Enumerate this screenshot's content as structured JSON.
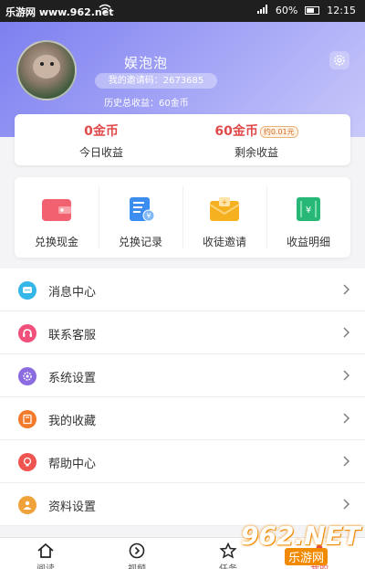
{
  "statusbar": {
    "source": "乐游网 www.962.net",
    "signal": "60%",
    "time": "12:15"
  },
  "profile": {
    "name": "娱泡泡",
    "invite_code": "我的邀请码：2673685",
    "history_earnings": "历史总收益：60金币"
  },
  "earnings": {
    "today_value": "0金币",
    "today_label": "今日收益",
    "remaining_value": "60金币",
    "remaining_badge": "约0.01元",
    "remaining_label": "剩余收益"
  },
  "actions": [
    {
      "label": "兑换现金",
      "icon": "wallet-icon",
      "color": "#f2616f"
    },
    {
      "label": "兑换记录",
      "icon": "receipt-icon",
      "color": "#3b8ef0"
    },
    {
      "label": "收徒邀请",
      "icon": "envelope-icon",
      "color": "#f5b11f"
    },
    {
      "label": "收益明细",
      "icon": "ledger-icon",
      "color": "#27b776"
    }
  ],
  "menu": [
    {
      "label": "消息中心",
      "icon": "message-icon",
      "color": "#35b6e8"
    },
    {
      "label": "联系客服",
      "icon": "headset-icon",
      "color": "#f0507a"
    },
    {
      "label": "系统设置",
      "icon": "settings-icon",
      "color": "#8a6be0"
    },
    {
      "label": "我的收藏",
      "icon": "bookmark-icon",
      "color": "#f37a2a"
    },
    {
      "label": "帮助中心",
      "icon": "lightbulb-icon",
      "color": "#ef5450"
    },
    {
      "label": "资料设置",
      "icon": "profile-icon",
      "color": "#f0a23a"
    }
  ],
  "tabs": [
    {
      "label": "阅读",
      "icon": "home-icon"
    },
    {
      "label": "视频",
      "icon": "play-icon"
    },
    {
      "label": "任务",
      "icon": "star-icon"
    },
    {
      "label": "我的",
      "icon": "user-icon"
    }
  ],
  "watermark": {
    "main": "962.NET",
    "sub": "乐游网"
  },
  "colors": {
    "accent": "#e14a4a",
    "header": "#7d7ff0"
  }
}
